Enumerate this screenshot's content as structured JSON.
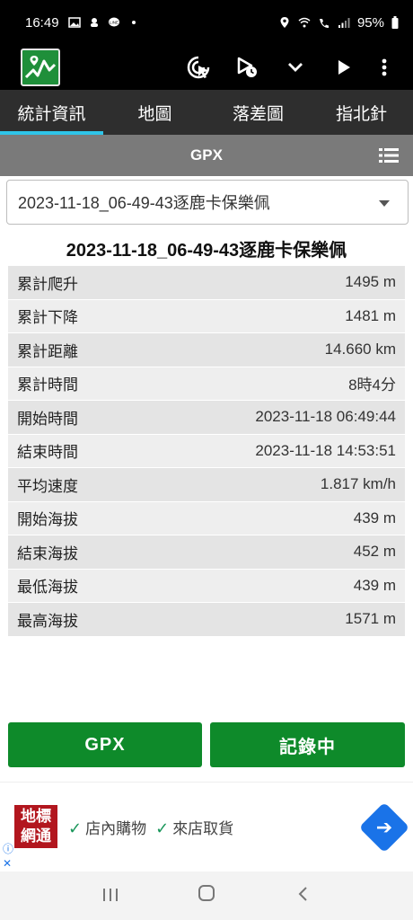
{
  "status_bar": {
    "time": "16:49",
    "battery": "95%"
  },
  "app": {
    "logo_icon": "mountain-chart-icon",
    "actions": [
      "track-target-icon",
      "play-timer-icon",
      "chevron-down-icon",
      "play-icon",
      "more-vert-icon"
    ]
  },
  "tabs": [
    {
      "label": "統計資訊",
      "active": true
    },
    {
      "label": "地圖",
      "active": false
    },
    {
      "label": "落差圖",
      "active": false
    },
    {
      "label": "指北針",
      "active": false
    }
  ],
  "gpx_bar": {
    "title": "GPX"
  },
  "dropdown": {
    "selected": "2023-11-18_06-49-43逐鹿卡保樂佩"
  },
  "track_title": "2023-11-18_06-49-43逐鹿卡保樂佩",
  "stats": [
    {
      "label": "累計爬升",
      "value": "1495 m"
    },
    {
      "label": "累計下降",
      "value": "1481 m"
    },
    {
      "label": "累計距離",
      "value": "14.660 km"
    },
    {
      "label": "累計時間",
      "value": "8時4分"
    },
    {
      "label": "開始時間",
      "value": "2023-11-18 06:49:44"
    },
    {
      "label": "結束時間",
      "value": "2023-11-18 14:53:51"
    },
    {
      "label": "平均速度",
      "value": "1.817 km/h"
    },
    {
      "label": "開始海拔",
      "value": "439 m"
    },
    {
      "label": "結束海拔",
      "value": "452 m"
    },
    {
      "label": "最低海拔",
      "value": "439 m"
    },
    {
      "label": "最高海拔",
      "value": "1571 m"
    }
  ],
  "buttons": {
    "gpx": "GPX",
    "recording": "記錄中"
  },
  "ad": {
    "logo_line1": "地標",
    "logo_line2": "網通",
    "item1": "店內購物",
    "item2": "來店取貨"
  },
  "colors": {
    "accent_tab": "#2ec4e8",
    "button_green": "#0e8a2a",
    "logo_green": "#1f8f3a",
    "ad_red": "#b2161e"
  }
}
